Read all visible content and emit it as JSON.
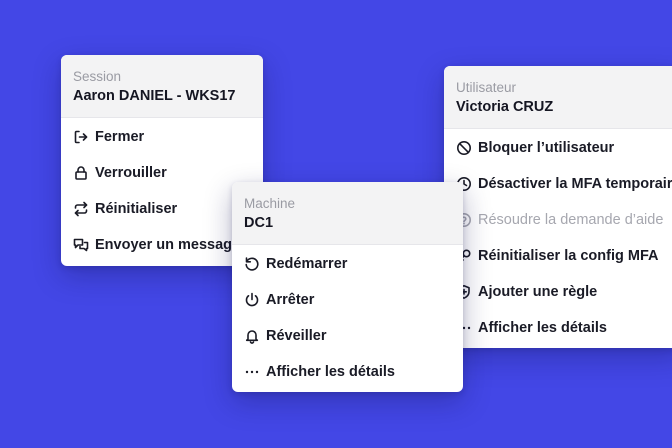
{
  "session_menu": {
    "label": "Session",
    "title": "Aaron DANIEL - WKS17",
    "items": [
      {
        "label": "Fermer",
        "icon": "logout-icon"
      },
      {
        "label": "Verrouiller",
        "icon": "lock-icon"
      },
      {
        "label": "Réinitialiser",
        "icon": "reset-arrows-icon"
      },
      {
        "label": "Envoyer un message",
        "icon": "messages-icon"
      }
    ]
  },
  "machine_menu": {
    "label": "Machine",
    "title": "DC1",
    "items": [
      {
        "label": "Redémarrer",
        "icon": "restart-icon"
      },
      {
        "label": "Arrêter",
        "icon": "power-icon"
      },
      {
        "label": "Réveiller",
        "icon": "bell-icon"
      },
      {
        "label": "Afficher les détails",
        "icon": "ellipsis-icon"
      }
    ]
  },
  "user_menu": {
    "label": "Utilisateur",
    "title": "Victoria CRUZ",
    "items": [
      {
        "label": "Bloquer l’utilisateur",
        "icon": "block-icon"
      },
      {
        "label": "Désactiver la MFA temporairement",
        "icon": "clock-icon"
      },
      {
        "label": "Résoudre la demande d’aide",
        "icon": "help-circle-icon",
        "disabled": true
      },
      {
        "label": "Réinitialiser la config MFA",
        "icon": "key-icon"
      },
      {
        "label": "Ajouter une règle",
        "icon": "shield-plus-icon"
      },
      {
        "label": "Afficher les détails",
        "icon": "ellipsis-icon"
      }
    ]
  },
  "colors": {
    "background": "#4347E6",
    "card": "#FFFFFF",
    "header": "#F3F3F4",
    "text": "#1A1B26",
    "muted": "#9A9BA3",
    "disabled": "#A6A7AF"
  }
}
